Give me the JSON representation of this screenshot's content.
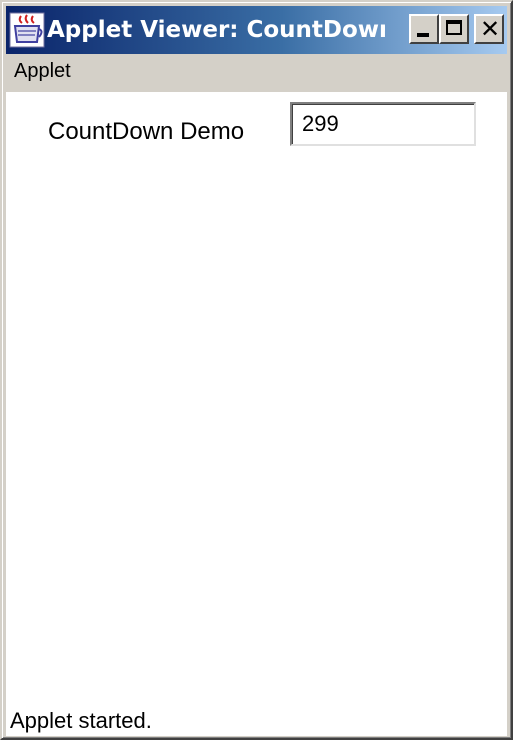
{
  "window": {
    "title": "Applet Viewer: CountDownDe...",
    "icon": "java-coffee-cup-icon",
    "controls": [
      "minimize-icon",
      "maximize-icon",
      "close-icon"
    ],
    "colors": {
      "titlebar_start": "#0a246a",
      "titlebar_end": "#a6caf0",
      "chrome": "#d4d0c8"
    }
  },
  "menubar": {
    "items": [
      {
        "label": "Applet"
      }
    ]
  },
  "main": {
    "label": "CountDown Demo",
    "counter_value": "299"
  },
  "status": {
    "text": "Applet started."
  }
}
